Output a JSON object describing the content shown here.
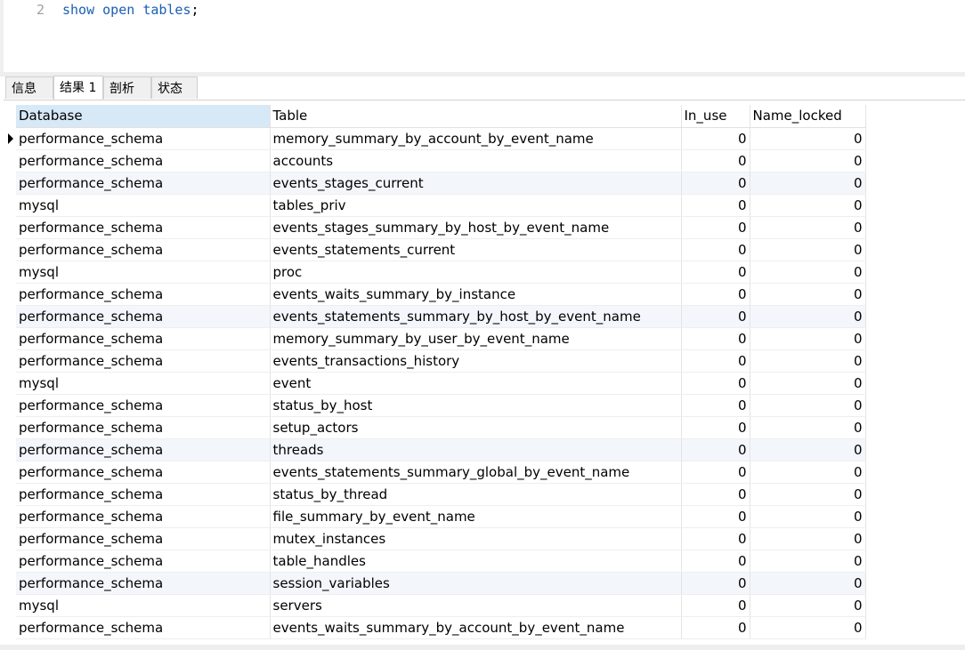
{
  "editor": {
    "line_number": "2",
    "code_kw1": "show",
    "code_kw2": "open",
    "code_kw3": "tables",
    "code_end": ";"
  },
  "tabs": [
    {
      "label": "信息"
    },
    {
      "label": "结果 1"
    },
    {
      "label": "剖析"
    },
    {
      "label": "状态"
    }
  ],
  "active_tab": "结果 1",
  "table": {
    "columns": [
      "Database",
      "Table",
      "In_use",
      "Name_locked"
    ],
    "rows": [
      [
        "performance_schema",
        "memory_summary_by_account_by_event_name",
        "0",
        "0"
      ],
      [
        "performance_schema",
        "accounts",
        "0",
        "0"
      ],
      [
        "performance_schema",
        "events_stages_current",
        "0",
        "0"
      ],
      [
        "mysql",
        "tables_priv",
        "0",
        "0"
      ],
      [
        "performance_schema",
        "events_stages_summary_by_host_by_event_name",
        "0",
        "0"
      ],
      [
        "performance_schema",
        "events_statements_current",
        "0",
        "0"
      ],
      [
        "mysql",
        "proc",
        "0",
        "0"
      ],
      [
        "performance_schema",
        "events_waits_summary_by_instance",
        "0",
        "0"
      ],
      [
        "performance_schema",
        "events_statements_summary_by_host_by_event_name",
        "0",
        "0"
      ],
      [
        "performance_schema",
        "memory_summary_by_user_by_event_name",
        "0",
        "0"
      ],
      [
        "performance_schema",
        "events_transactions_history",
        "0",
        "0"
      ],
      [
        "mysql",
        "event",
        "0",
        "0"
      ],
      [
        "performance_schema",
        "status_by_host",
        "0",
        "0"
      ],
      [
        "performance_schema",
        "setup_actors",
        "0",
        "0"
      ],
      [
        "performance_schema",
        "threads",
        "0",
        "0"
      ],
      [
        "performance_schema",
        "events_statements_summary_global_by_event_name",
        "0",
        "0"
      ],
      [
        "performance_schema",
        "status_by_thread",
        "0",
        "0"
      ],
      [
        "performance_schema",
        "file_summary_by_event_name",
        "0",
        "0"
      ],
      [
        "performance_schema",
        "mutex_instances",
        "0",
        "0"
      ],
      [
        "performance_schema",
        "table_handles",
        "0",
        "0"
      ],
      [
        "performance_schema",
        "session_variables",
        "0",
        "0"
      ],
      [
        "mysql",
        "servers",
        "0",
        "0"
      ],
      [
        "performance_schema",
        "events_waits_summary_by_account_by_event_name",
        "0",
        "0"
      ]
    ]
  }
}
